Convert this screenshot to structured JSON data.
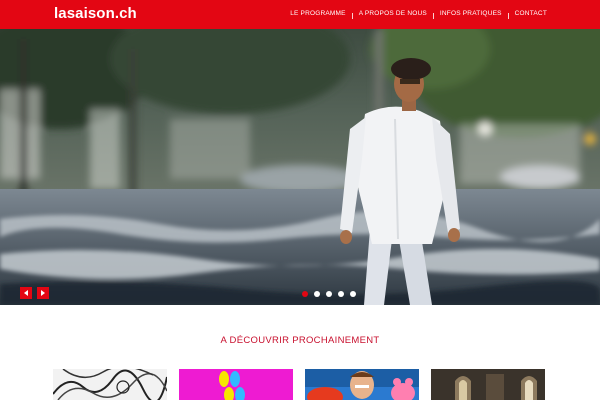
{
  "header": {
    "logo": "lasaison.ch",
    "nav": [
      {
        "label": "LE PROGRAMME"
      },
      {
        "label": "A PROPOS DE NOUS"
      },
      {
        "label": "INFOS PRATIQUES"
      },
      {
        "label": "CONTACT"
      }
    ]
  },
  "hero": {
    "slide_count": 5,
    "active_slide": 1
  },
  "section": {
    "title": "A DÉCOUVRIR PROCHAINEMENT"
  },
  "thumbnails": [
    {
      "name": "thumb-1"
    },
    {
      "name": "thumb-2"
    },
    {
      "name": "thumb-3"
    },
    {
      "name": "thumb-4"
    }
  ],
  "colors": {
    "brand_red": "#e30613",
    "title_red": "#c8102e"
  }
}
